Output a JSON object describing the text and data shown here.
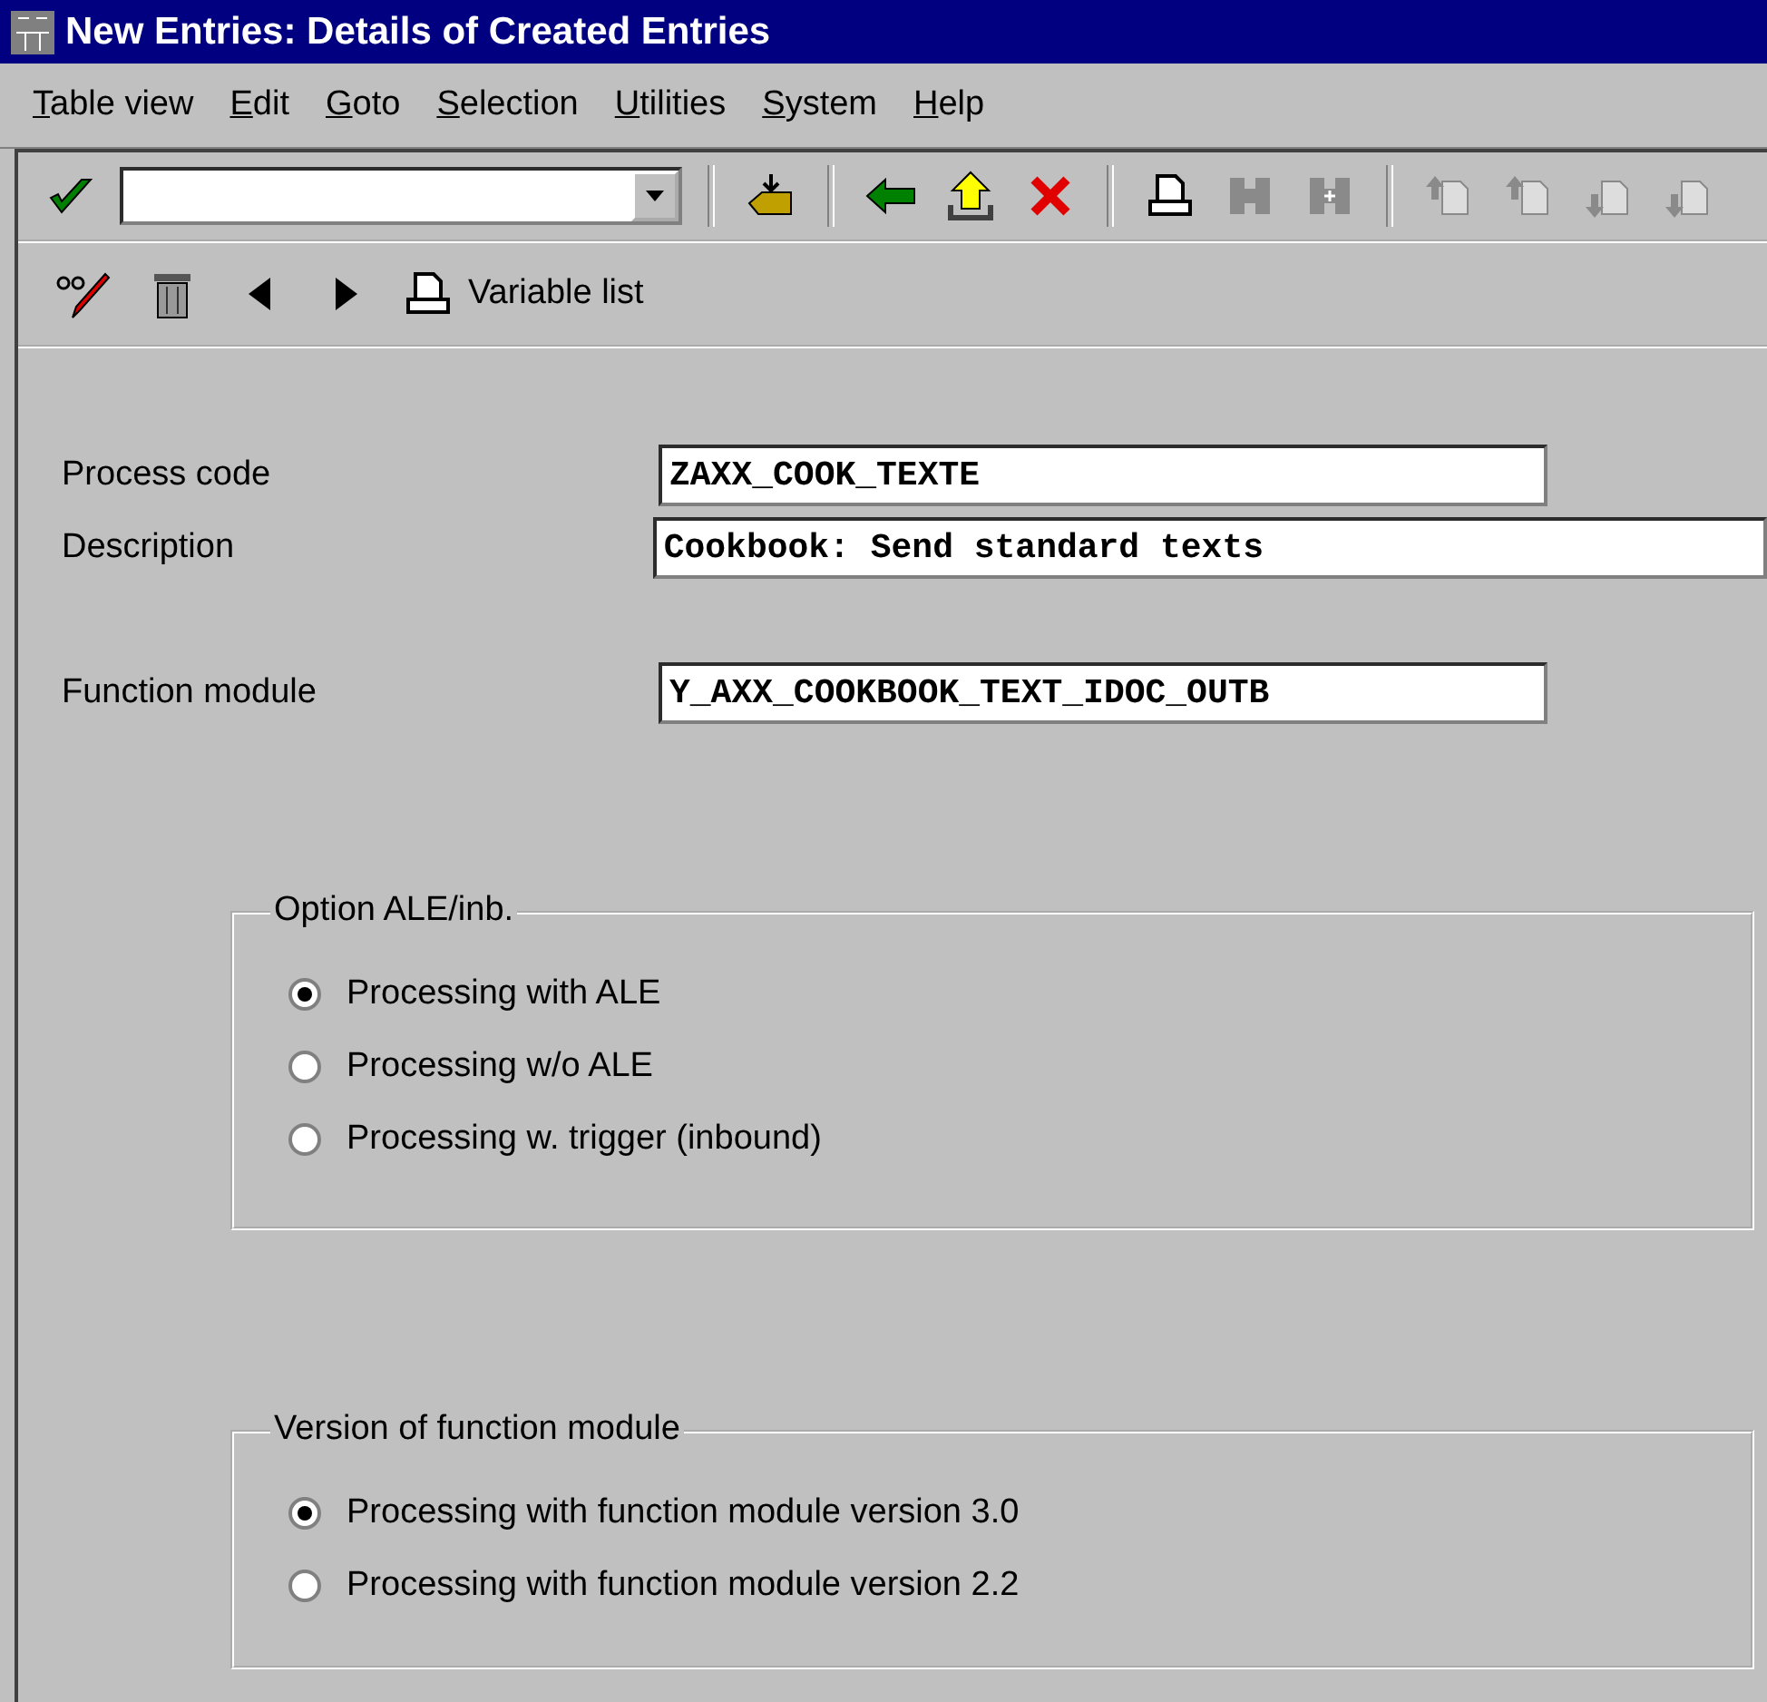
{
  "window": {
    "title": "New Entries: Details of Created Entries"
  },
  "menu": [
    "Table view",
    "Edit",
    "Goto",
    "Selection",
    "Utilities",
    "System",
    "Help"
  ],
  "standard_toolbar": [
    {
      "kind": "enter",
      "disabled": false
    },
    {
      "kind": "command"
    },
    {
      "kind": "sep"
    },
    {
      "kind": "save",
      "disabled": false
    },
    {
      "kind": "sep"
    },
    {
      "kind": "back",
      "disabled": false
    },
    {
      "kind": "exit",
      "disabled": false
    },
    {
      "kind": "cancel",
      "disabled": false
    },
    {
      "kind": "sep"
    },
    {
      "kind": "print",
      "disabled": false
    },
    {
      "kind": "find",
      "disabled": true
    },
    {
      "kind": "findnext",
      "disabled": true
    },
    {
      "kind": "sep"
    },
    {
      "kind": "first",
      "disabled": true
    },
    {
      "kind": "prev",
      "disabled": true
    },
    {
      "kind": "next",
      "disabled": true
    },
    {
      "kind": "last",
      "disabled": true
    }
  ],
  "app_toolbar": [
    {
      "kind": "display-change"
    },
    {
      "kind": "delete"
    },
    {
      "kind": "previous"
    },
    {
      "kind": "forward"
    },
    {
      "kind": "print",
      "label": "Variable list"
    }
  ],
  "fields": [
    {
      "label": "Process code",
      "value": "ZAXX_COOK_TEXTE",
      "kind": "short"
    },
    {
      "label": "Description",
      "value": "Cookbook: Send standard texts",
      "kind": "long"
    },
    {
      "label": "Function module",
      "value": "Y_AXX_COOKBOOK_TEXT_IDOC_OUTB",
      "kind": "short"
    }
  ],
  "groups": [
    {
      "title": "Option ALE/inb.",
      "options": [
        {
          "label": "Processing with ALE",
          "selected": true
        },
        {
          "label": "Processing w/o ALE",
          "selected": false
        },
        {
          "label": "Processing w. trigger (inbound)",
          "selected": false
        }
      ]
    },
    {
      "title": "Version of function module",
      "options": [
        {
          "label": "Processing with function module version 3.0",
          "selected": true
        },
        {
          "label": "Processing with function module version 2.2",
          "selected": false
        }
      ]
    }
  ]
}
